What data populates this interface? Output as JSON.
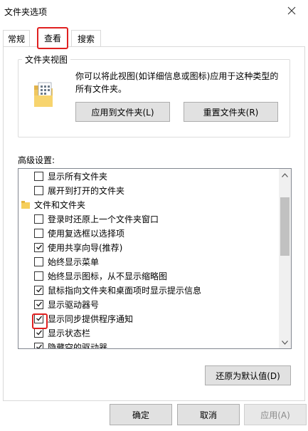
{
  "window": {
    "title": "文件夹选项"
  },
  "tabs": [
    {
      "label": "常规"
    },
    {
      "label": "查看"
    },
    {
      "label": "搜索"
    }
  ],
  "folder_views": {
    "group_title": "文件夹视图",
    "description": "你可以将此视图(如详细信息或图标)应用于这种类型的所有文件夹。",
    "apply_label": "应用到文件夹(L)",
    "reset_label": "重置文件夹(R)"
  },
  "advanced": {
    "label": "高级设置:",
    "items": [
      {
        "type": "checkbox",
        "checked": false,
        "label": "显示所有文件夹"
      },
      {
        "type": "checkbox",
        "checked": false,
        "label": "展开到打开的文件夹"
      },
      {
        "type": "folder",
        "label": "文件和文件夹"
      },
      {
        "type": "checkbox",
        "checked": false,
        "label": "登录时还原上一个文件夹窗口"
      },
      {
        "type": "checkbox",
        "checked": false,
        "label": "使用复选框以选择项"
      },
      {
        "type": "checkbox",
        "checked": true,
        "label": "使用共享向导(推荐)"
      },
      {
        "type": "checkbox",
        "checked": false,
        "label": "始终显示菜单"
      },
      {
        "type": "checkbox",
        "checked": false,
        "label": "始终显示图标，从不显示缩略图"
      },
      {
        "type": "checkbox",
        "checked": true,
        "label": "鼠标指向文件夹和桌面项时显示提示信息"
      },
      {
        "type": "checkbox",
        "checked": true,
        "label": "显示驱动器号"
      },
      {
        "type": "checkbox",
        "checked": true,
        "label": "显示同步提供程序通知"
      },
      {
        "type": "checkbox",
        "checked": true,
        "label": "显示状态栏"
      },
      {
        "type": "checkbox",
        "checked": true,
        "label": "隐藏空的驱动器"
      }
    ]
  },
  "buttons": {
    "restore_defaults": "还原为默认值(D)",
    "ok": "确定",
    "cancel": "取消",
    "apply": "应用(A)"
  },
  "colors": {
    "highlight": "#e02020"
  }
}
